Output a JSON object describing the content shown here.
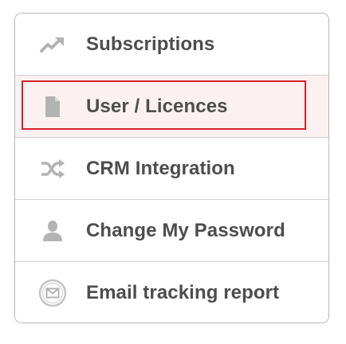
{
  "menu": {
    "items": [
      {
        "label": "Subscriptions",
        "icon": "trending-up-icon",
        "active": false
      },
      {
        "label": "User / Licences",
        "icon": "document-icon",
        "active": true
      },
      {
        "label": "CRM Integration",
        "icon": "shuffle-icon",
        "active": false
      },
      {
        "label": "Change My Password",
        "icon": "user-icon",
        "active": false
      },
      {
        "label": "Email tracking report",
        "icon": "envelope-icon",
        "active": false
      }
    ]
  },
  "colors": {
    "active_border": "#d2232a",
    "active_background": "#fbf1f1",
    "label_text": "#4d4d4d",
    "icon": "#b3b3b3"
  }
}
